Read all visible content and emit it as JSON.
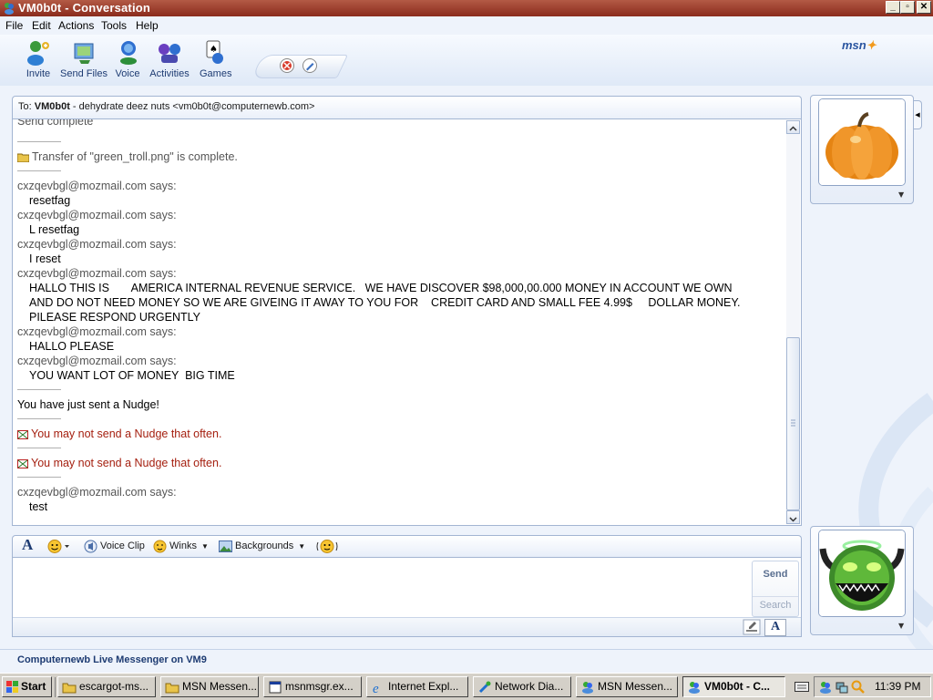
{
  "window": {
    "title": "VM0b0t - Conversation",
    "min": "_",
    "max": "▫",
    "close": "✕"
  },
  "menu": [
    "File",
    "Edit",
    "Actions",
    "Tools",
    "Help"
  ],
  "toolbar": {
    "items": [
      {
        "label": "Invite",
        "icon": "invite-icon"
      },
      {
        "label": "Send Files",
        "icon": "send-files-icon"
      },
      {
        "label": "Voice",
        "icon": "voice-icon"
      },
      {
        "label": "Activities",
        "icon": "activities-icon"
      },
      {
        "label": "Games",
        "icon": "games-icon"
      }
    ],
    "block_icon": "block-icon",
    "pen_icon": "pen-icon",
    "logo": "msn"
  },
  "to_bar": {
    "prefix": "To:",
    "name": "VM0b0t",
    "rest": " - dehydrate deez nuts <vm0b0t@computernewb.com>"
  },
  "history": {
    "top_partial": "Send complete",
    "transfer": "Transfer of \"green_troll.png\" is complete.",
    "messages": [
      {
        "sender": "cxzqevbgl@mozmail.com says:",
        "lines": [
          "resetfag"
        ]
      },
      {
        "sender": "cxzqevbgl@mozmail.com says:",
        "lines": [
          "L resetfag"
        ]
      },
      {
        "sender": "cxzqevbgl@mozmail.com says:",
        "lines": [
          "I reset"
        ]
      },
      {
        "sender": "cxzqevbgl@mozmail.com says:",
        "lines": [
          "HALLO THIS IS       AMERICA INTERNAL REVENUE SERVICE.   WE HAVE DISCOVER $98,000,00.000 MONEY IN ACCOUNT WE OWN",
          "AND DO NOT NEED MONEY SO WE ARE GIVEING IT AWAY TO YOU FOR    CREDIT CARD AND SMALL FEE 4.99$     DOLLAR MONEY.",
          "PILEASE RESPOND URGENTLY"
        ]
      },
      {
        "sender": "cxzqevbgl@mozmail.com says:",
        "lines": [
          "HALLO PLEASE"
        ]
      },
      {
        "sender": "cxzqevbgl@mozmail.com says:",
        "lines": [
          "YOU WANT LOT OF MONEY  BIG TIME"
        ]
      }
    ],
    "nudge_sent": "You have just sent a Nudge!",
    "nudge_warn_1": "You may not send a Nudge that often.",
    "nudge_warn_2": "You may not send a Nudge that often.",
    "last": {
      "sender": "cxzqevbgl@mozmail.com says:",
      "lines": [
        "test"
      ]
    }
  },
  "format_bar": {
    "font_label": "A",
    "voice_clip": "Voice Clip",
    "winks": "Winks",
    "backgrounds": "Backgrounds"
  },
  "input": {
    "value": "",
    "send": "Send",
    "search": "Search",
    "font_label": "A"
  },
  "status": "Computernewb Live Messenger on VM9",
  "taskbar": {
    "start": "Start",
    "tasks": [
      {
        "label": "escargot-ms...",
        "icon": "folder-icon"
      },
      {
        "label": "MSN Messen...",
        "icon": "folder-icon"
      },
      {
        "label": "msnmsgr.ex...",
        "icon": "app-icon"
      },
      {
        "label": "Internet Expl...",
        "icon": "ie-icon"
      },
      {
        "label": "Network Dia...",
        "icon": "network-icon"
      },
      {
        "label": "MSN Messen...",
        "icon": "msn-icon"
      },
      {
        "label": "VM0b0t - C...",
        "icon": "msn-icon",
        "active": true
      }
    ],
    "clock": "11:39 PM"
  }
}
